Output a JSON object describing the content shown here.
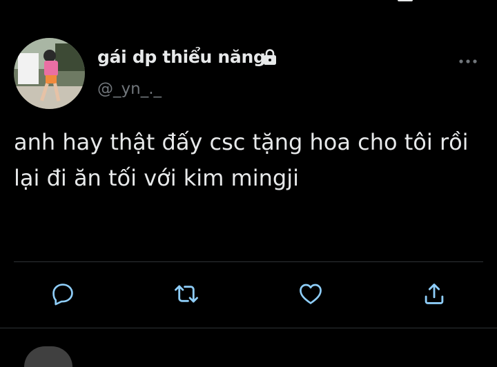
{
  "tweet": {
    "author": {
      "display_name": "gái dp thiểu năng",
      "handle": "@_yn_._",
      "lock_icon": "lock-icon",
      "avatar": "avatar-photo"
    },
    "more_icon": "more-horizontal-icon",
    "text": "anh hay thật đấy csc tặng hoa cho tôi rồi\nlại đi ăn tối với kim mingji",
    "actions": [
      {
        "name": "reply",
        "icon": "reply-icon"
      },
      {
        "name": "retweet",
        "icon": "retweet-icon"
      },
      {
        "name": "like",
        "icon": "heart-icon"
      },
      {
        "name": "share",
        "icon": "share-icon"
      }
    ]
  },
  "colors": {
    "background": "#000000",
    "text_primary": "#e7e9ea",
    "text_secondary": "#71767b",
    "icon": "#8ecdf8",
    "divider": "#2f3336"
  }
}
